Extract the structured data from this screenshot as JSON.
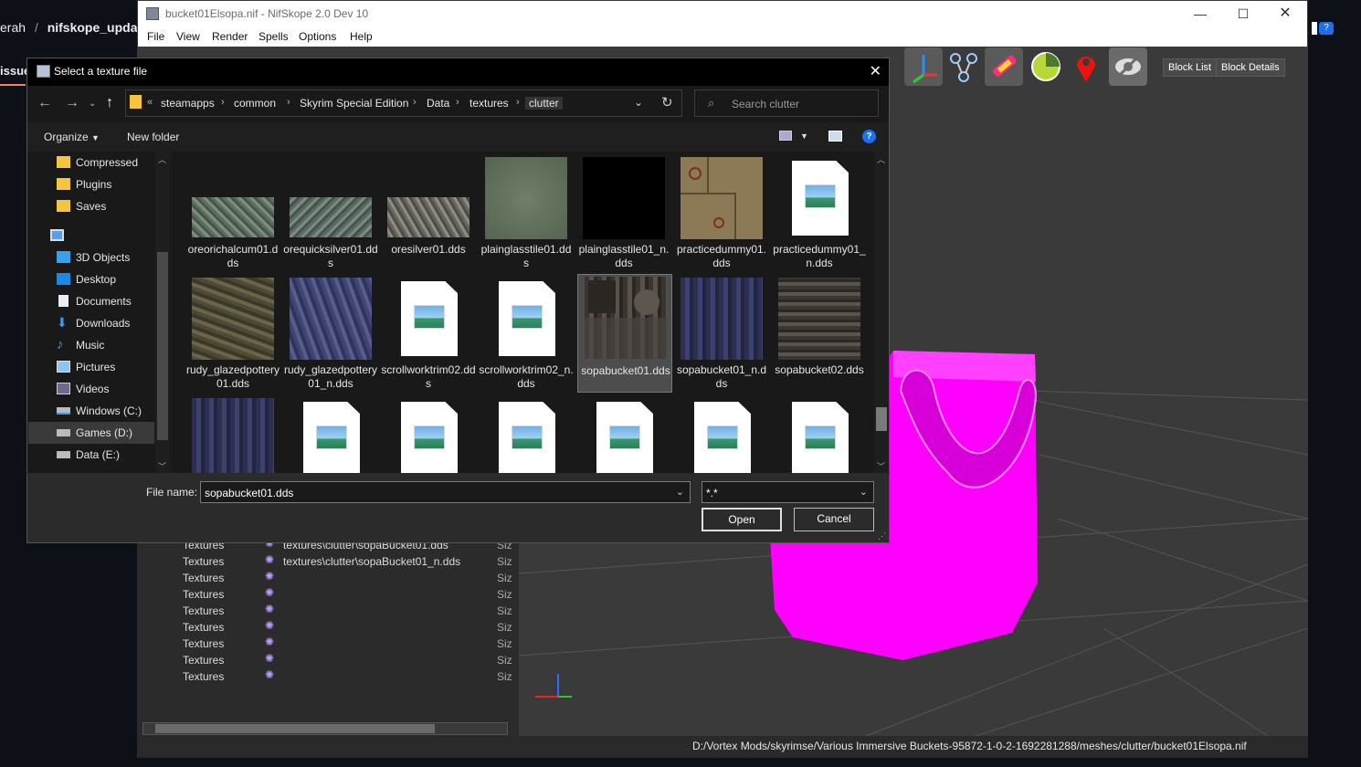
{
  "background_page": {
    "crumb_user": "erah",
    "crumb_sep": "/",
    "crumb_repo": "nifskope_update",
    "tab": "issues",
    "help_icon": "?"
  },
  "nifskope": {
    "title": "bucket01Elsopa.nif - NifSkope 2.0 Dev 10",
    "menu": [
      "File",
      "View",
      "Render",
      "Spells",
      "Options",
      "Help"
    ],
    "toolbar_buttons": [
      "Block List",
      "Block Details"
    ],
    "status_path": "D:/Vortex Mods/skyrimse/Various Immersive Buckets-95872-1-0-2-1692281288/meshes/clutter/bucket01Elsopa.nif",
    "rows": [
      {
        "name": "Textures",
        "path": "textures\\clutter\\sopaBucket01.dds",
        "size": "Siz"
      },
      {
        "name": "Textures",
        "path": "textures\\clutter\\sopaBucket01_n.dds",
        "size": "Siz"
      },
      {
        "name": "Textures",
        "path": "",
        "size": "Siz"
      },
      {
        "name": "Textures",
        "path": "",
        "size": "Siz"
      },
      {
        "name": "Textures",
        "path": "",
        "size": "Siz"
      },
      {
        "name": "Textures",
        "path": "",
        "size": "Siz"
      },
      {
        "name": "Textures",
        "path": "",
        "size": "Siz"
      },
      {
        "name": "Textures",
        "path": "",
        "size": "Siz"
      },
      {
        "name": "Textures",
        "path": "",
        "size": "Siz"
      }
    ]
  },
  "dialog": {
    "title": "Select a texture file",
    "breadcrumb": [
      "steamapps",
      "common",
      "Skyrim Special Edition",
      "Data",
      "textures",
      "clutter"
    ],
    "overflow": "«",
    "search_placeholder": "Search clutter",
    "organize": "Organize",
    "new_folder": "New folder",
    "nav_items": [
      {
        "label": "Compressed",
        "icon": "folder-icon"
      },
      {
        "label": "Plugins",
        "icon": "folder-icon"
      },
      {
        "label": "Saves",
        "icon": "folder-icon"
      },
      {
        "label": "",
        "icon": "computer-icon"
      },
      {
        "label": "3D Objects",
        "icon": "cube-icon"
      },
      {
        "label": "Desktop",
        "icon": "desktop-icon"
      },
      {
        "label": "Documents",
        "icon": "document-icon"
      },
      {
        "label": "Downloads",
        "icon": "download-icon"
      },
      {
        "label": "Music",
        "icon": "music-icon"
      },
      {
        "label": "Pictures",
        "icon": "pictures-icon"
      },
      {
        "label": "Videos",
        "icon": "video-icon"
      },
      {
        "label": "Windows (C:)",
        "icon": "drive-icon"
      },
      {
        "label": "Games (D:)",
        "icon": "drive-icon"
      },
      {
        "label": "Data (E:)",
        "icon": "drive-icon"
      }
    ],
    "files_row1": [
      {
        "name": "oreorichalcum01.dds",
        "kind": "tex-green"
      },
      {
        "name": "orequicksilver01.dds",
        "kind": "tex-green"
      },
      {
        "name": "oresilver01.dds",
        "kind": "tex-gray"
      },
      {
        "name": "plainglasstile01.dds",
        "kind": "tex-glass"
      },
      {
        "name": "plainglasstile01_n.dds",
        "kind": "tex-black"
      },
      {
        "name": "practicedummy01.dds",
        "kind": "tex-dummy"
      },
      {
        "name": "practicedummy01_n.dds",
        "kind": "doc"
      }
    ],
    "files_row2": [
      {
        "name": "rudy_glazedpottery01.dds",
        "kind": "tex-brown"
      },
      {
        "name": "rudy_glazedpottery01_n.dds",
        "kind": "tex-blue"
      },
      {
        "name": "scrollworktrim02.dds",
        "kind": "doc"
      },
      {
        "name": "scrollworktrim02_n.dds",
        "kind": "doc"
      },
      {
        "name": "sopabucket01.dds",
        "kind": "tex-wood"
      },
      {
        "name": "sopabucket01_n.dds",
        "kind": "tex-bluewood"
      },
      {
        "name": "sopabucket02.dds",
        "kind": "tex-wood2"
      }
    ],
    "file_name_label": "File name:",
    "file_name_value": "sopabucket01.dds",
    "file_type_value": "*.*",
    "open": "Open",
    "cancel": "Cancel"
  }
}
